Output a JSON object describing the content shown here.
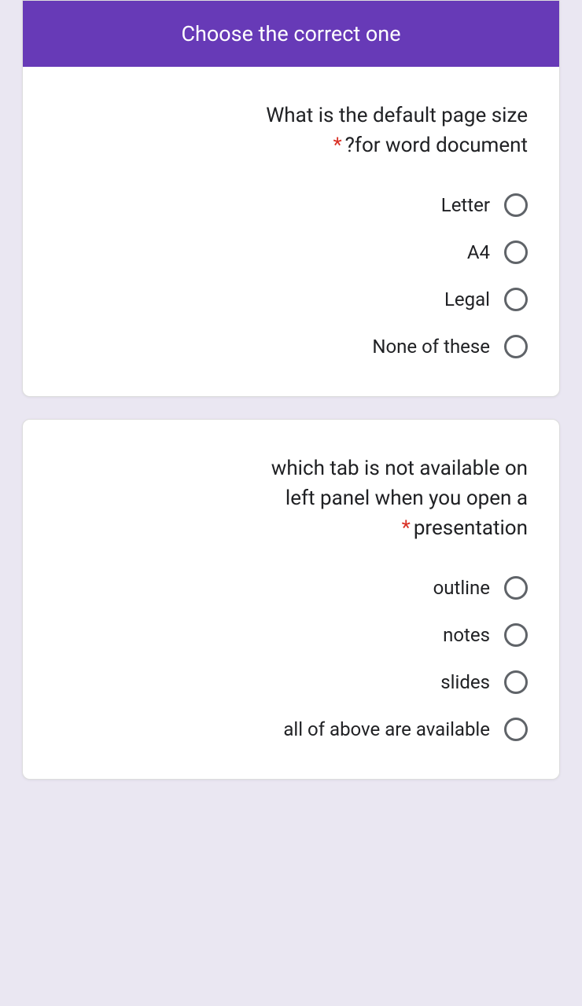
{
  "header": {
    "title": "Choose the correct one"
  },
  "questions": [
    {
      "line1": "What is the default page size",
      "line2": "?for word document",
      "required": "*",
      "options": [
        {
          "label": "Letter"
        },
        {
          "label": "A4"
        },
        {
          "label": "Legal"
        },
        {
          "label": "None of these"
        }
      ]
    },
    {
      "line1": "which tab is not available on",
      "line2": "left panel when you open a",
      "line3": "presentation",
      "required": "*",
      "options": [
        {
          "label": "outline"
        },
        {
          "label": "notes"
        },
        {
          "label": "slides"
        },
        {
          "label": "all of above are available"
        }
      ]
    }
  ]
}
